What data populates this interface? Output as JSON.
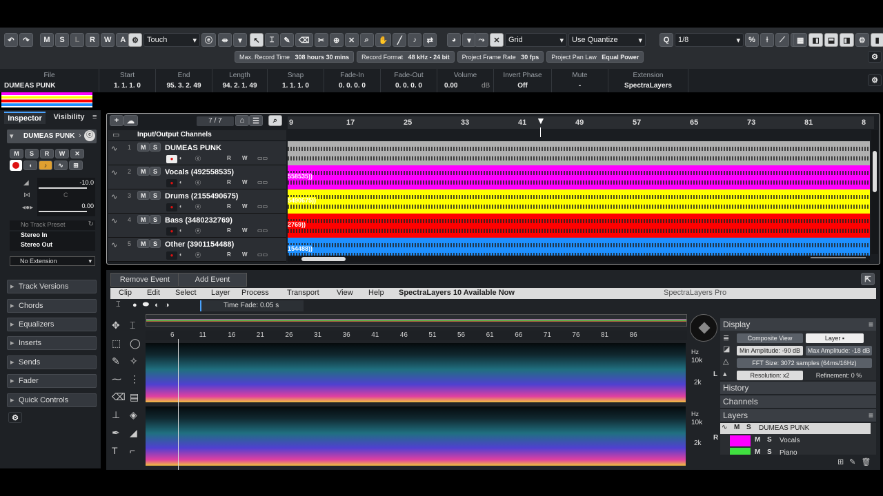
{
  "toolbar": {
    "msl": [
      "M",
      "S",
      "L",
      "R",
      "W",
      "A"
    ],
    "automation_mode": "Touch",
    "grid_type": "Grid",
    "quantize_mode": "Use Quantize",
    "quantize_value": "1/8",
    "status": [
      {
        "label": "Max. Record Time",
        "value": "308 hours 30 mins"
      },
      {
        "label": "Record Format",
        "value": "48 kHz - 24 bit"
      },
      {
        "label": "Project Frame Rate",
        "value": "30 fps"
      },
      {
        "label": "Project Pan Law",
        "value": "Equal Power"
      }
    ]
  },
  "infoline": {
    "headers": [
      "File",
      "Start",
      "End",
      "Length",
      "Snap",
      "Fade-In",
      "Fade-Out",
      "Volume",
      "Invert Phase",
      "Mute",
      "Extension"
    ],
    "file": "DUMEAS PUNK",
    "start": "1. 1. 1. 0",
    "end": "95. 3. 2. 49",
    "length": "94. 2. 1. 49",
    "snap": "1. 1. 1. 0",
    "fadein": "0. 0. 0. 0",
    "fadeout": "0. 0. 0. 0",
    "volume": "0.00",
    "volume_unit": "dB",
    "invert": "Off",
    "mute": "-",
    "extension": "SpectraLayers"
  },
  "inspector": {
    "tab_inspector": "Inspector",
    "tab_visibility": "Visibility",
    "track_name": "DUMEAS PUNK",
    "vol": "-10.0",
    "pan": "C",
    "send": "0.00",
    "no_track_preset": "No Track Preset",
    "stereo_in": "Stereo In",
    "stereo_out": "Stereo Out",
    "no_extension": "No Extension",
    "sections": [
      "Track Versions",
      "Chords",
      "Equalizers",
      "Inserts",
      "Sends",
      "Fader",
      "Quick Controls"
    ]
  },
  "tracklist": {
    "count": "7 / 7",
    "folder": "Input/Output Channels",
    "tracks": [
      {
        "num": "1",
        "name": "DUMEAS PUNK",
        "color": "#b0b0b0",
        "clip": ""
      },
      {
        "num": "2",
        "name": "Vocals (492558535)",
        "color": "#ff00ff",
        "clip": "558535))"
      },
      {
        "num": "3",
        "name": "Drums (2155490675)",
        "color": "#ffff00",
        "clip": "5490675))"
      },
      {
        "num": "4",
        "name": "Bass (3480232769)",
        "color": "#ff0000",
        "clip": "2769))"
      },
      {
        "num": "5",
        "name": "Other (3901154488)",
        "color": "#1e90ff",
        "clip": "154488))"
      }
    ],
    "ruler": [
      "9",
      "17",
      "25",
      "33",
      "41",
      "49",
      "57",
      "65",
      "73",
      "81",
      "8"
    ]
  },
  "lower": {
    "remove_event": "Remove Event",
    "add_event": "Add Event",
    "menu": [
      "Clip",
      "Edit",
      "Select",
      "Layer",
      "Process",
      "Transport",
      "View",
      "Help"
    ],
    "promo": "SpectraLayers 10 Available Now",
    "app": "SpectraLayers Pro",
    "time_fade": "Time Fade: 0.05 s",
    "ruler": [
      "6",
      "11",
      "16",
      "21",
      "26",
      "31",
      "36",
      "41",
      "46",
      "51",
      "56",
      "61",
      "66",
      "71",
      "76",
      "81",
      "86"
    ],
    "hz": "Hz",
    "k10": "10k",
    "k2": "2k",
    "ch_l": "L",
    "ch_r": "R",
    "display": "Display",
    "composite": "Composite View",
    "layer_mode": "Layer ▪",
    "min_amp": "Min Amplitude: -90 dB",
    "max_amp": "Max Amplitude: -18 dB",
    "fft": "FFT Size: 3072 samples (64ms/16Hz)",
    "resolution": "Resolution: x2",
    "refinement": "Refinement: 0 %",
    "history": "History",
    "channels": "Channels",
    "layers": "Layers",
    "layer_items": [
      "DUMEAS PUNK",
      "Vocals",
      "Piano"
    ]
  }
}
